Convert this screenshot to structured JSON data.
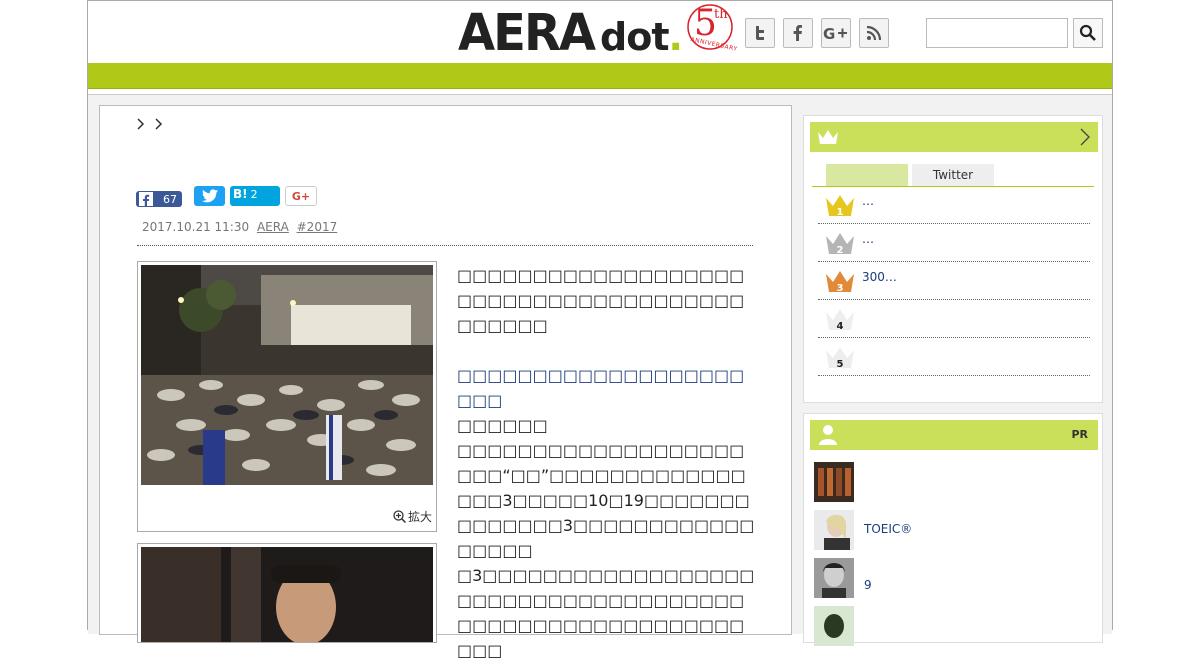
{
  "header": {
    "logo_main": "AERA",
    "logo_sub": "dot",
    "logo_period": ".",
    "badge_number": "5",
    "badge_suffix": "th",
    "badge_caption": "ANNIVERSARY",
    "social": [
      {
        "name": "twitter",
        "glyph": "t"
      },
      {
        "name": "facebook",
        "glyph": "f"
      },
      {
        "name": "google-plus",
        "glyph": "G+"
      },
      {
        "name": "rss",
        "glyph": "rss"
      }
    ],
    "search_placeholder": ""
  },
  "breadcrumb": [
    ">",
    ">"
  ],
  "share": {
    "facebook_count": "67",
    "hatena_label": "B!",
    "hatena_count": "2",
    "gplus_label": "G+"
  },
  "meta": {
    "date": "2017.10.21 11:30",
    "source": "AERA",
    "tag": "#2017"
  },
  "photo": {
    "enlarge_label": "拡大"
  },
  "article": {
    "p1": "□□□□□□□□□□□□□□□□□□□□□□□□□□□□□□□□□□□□□□□□□□□□",
    "link": "□□□□□□□□□□□□□□□□□□□□□□",
    "p2_head": "□□□□□□",
    "p2": "□□□□□□□□□□□□□□□□□□□□□□“□□”□□□□□□□□□□□□□□□□3□□□□□10□19□□□□□□□□□□□□□□3□□□□□□□□□□□□□□□□□",
    "p3": "□3□□□□□□□□□□□□□□□□□□□□□□□□□□□□□□□□□□□□□□□□□□□□□□□□□□□□□□□□□□□"
  },
  "ranking": {
    "tabs": [
      "",
      "Twitter"
    ],
    "items": [
      {
        "rank": "1",
        "text": "…"
      },
      {
        "rank": "2",
        "text": "…"
      },
      {
        "rank": "3",
        "text": "300…"
      },
      {
        "rank": "4",
        "text": ""
      },
      {
        "rank": "5",
        "text": ""
      }
    ]
  },
  "pr": {
    "badge": "PR",
    "items": [
      {
        "text": ""
      },
      {
        "text": "TOEIC®"
      },
      {
        "text": "9"
      },
      {
        "text": ""
      }
    ]
  },
  "colors": {
    "accent": "#b0c818",
    "sidebar_head": "#cbe05a",
    "link": "#1a3c7a",
    "twitter": "#1da1f2",
    "facebook": "#3b5998",
    "hatena": "#00a4de"
  }
}
